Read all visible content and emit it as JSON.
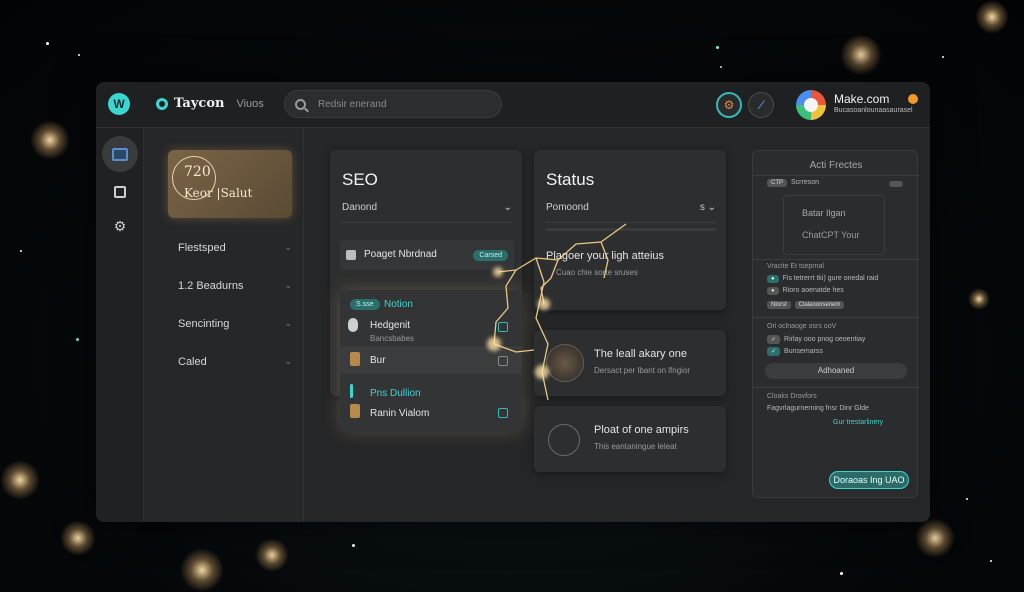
{
  "header": {
    "brand_name": "Taycon",
    "brand_sub": "Viuos",
    "search_placeholder": "Redsir enerand",
    "account_name": "Make.com",
    "account_sub": "Bucasoanlounaasaurasel"
  },
  "sidebar": {
    "promo_number": "720",
    "promo_text": "Keor |Salut",
    "items": [
      {
        "label": "Flestsped"
      },
      {
        "label": "1.2 Beadurns"
      },
      {
        "label": "Sencinting"
      },
      {
        "label": "Caled"
      }
    ]
  },
  "seo_card": {
    "title": "SEO",
    "select_label": "Danond",
    "row1_label": "Poaget Nbrdnad",
    "row1_badge": "Carsed",
    "list_pill": "S.sse",
    "list_title": "Notion",
    "list_items": [
      {
        "label": "Hedgenit",
        "sub": "Bancsbabes"
      },
      {
        "label": "Bur"
      },
      {
        "label": "Pns Dullion"
      },
      {
        "label": "Ranin Vialom"
      }
    ]
  },
  "status_card": {
    "title": "Status",
    "select_label": "Pomoond",
    "select_suffix": "s",
    "row1_label": "Plagoer your ligh atteius",
    "row1_sub": "Cuao chie sorte sruses"
  },
  "feature_cards": [
    {
      "title": "The leall akary one",
      "sub": "Dersact per lbant on lfngior"
    },
    {
      "title": "Ploat of one ampirs",
      "sub": "This eantaningue leleat"
    }
  ],
  "right_panel": {
    "title": "Acti Frectes",
    "tag1": "CTP",
    "tag1_text": "Scrreson",
    "box_line1": "Batar Ilgan",
    "box_line2": "ChatCPT Your",
    "section1_title": "Vracite Et tseprnal",
    "section1_line1": "Fis tetrerrt tki) gure onedal raid",
    "section1_line2": "Rioro aoenatde hes",
    "section1_tags": [
      "Nlorst",
      "Clalaoonsenem"
    ],
    "section2_title": "Ori oclnaoge osrs ooV",
    "section2_line1": "Rirlay ooo pnog oeoentiay",
    "section2_line2": "Bunsemarss",
    "button_label": "Adhoaned",
    "section3_title": "Cloaks Drovfors",
    "section3_line1": "Fagvrlagurnerning fnsr Dinr Glde",
    "section3_line2": "Gur trestarlinery",
    "cta_label": "Doraoas Ing UAO"
  },
  "icons": {
    "logo": "app-logo-icon",
    "search": "search-icon",
    "bolt": "bolt-icon"
  },
  "colors": {
    "accent": "#3ad6d2",
    "panel": "#2d2e2f",
    "background": "#252627"
  }
}
